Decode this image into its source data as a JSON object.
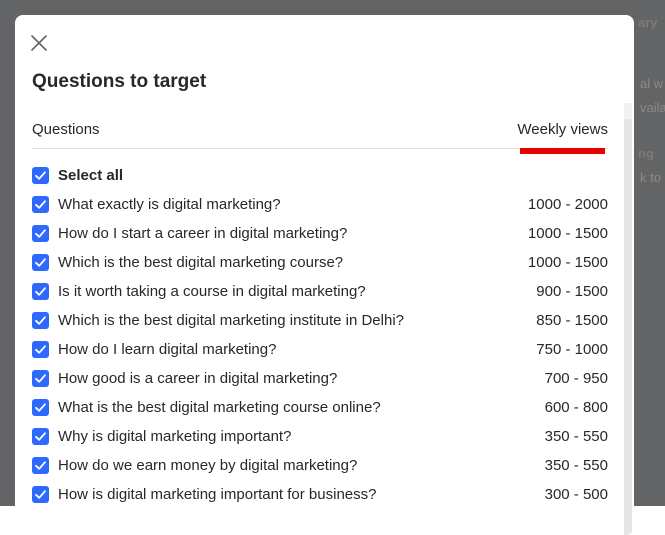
{
  "background": {
    "snippets": [
      "ary",
      "al w",
      "vaila",
      "ng",
      "k to"
    ]
  },
  "modal": {
    "title": "Questions to target",
    "columns": {
      "questions": "Questions",
      "weekly_views": "Weekly views"
    },
    "select_all": {
      "label": "Select all",
      "checked": true
    },
    "questions": [
      {
        "text": "What exactly is digital marketing?",
        "views": "1000 - 2000",
        "checked": true
      },
      {
        "text": "How do I start a career in digital marketing?",
        "views": "1000 - 1500",
        "checked": true
      },
      {
        "text": "Which is the best digital marketing course?",
        "views": "1000 - 1500",
        "checked": true
      },
      {
        "text": "Is it worth taking a course in digital marketing?",
        "views": "900 - 1500",
        "checked": true
      },
      {
        "text": "Which is the best digital marketing institute in Delhi?",
        "views": "850 - 1500",
        "checked": true
      },
      {
        "text": "How do I learn digital marketing?",
        "views": "750 - 1000",
        "checked": true
      },
      {
        "text": "How good is a career in digital marketing?",
        "views": "700 - 950",
        "checked": true
      },
      {
        "text": "What is the best digital marketing course online?",
        "views": "600 - 800",
        "checked": true
      },
      {
        "text": "Why is digital marketing important?",
        "views": "350 - 550",
        "checked": true
      },
      {
        "text": "How do we earn money by digital marketing?",
        "views": "350 - 550",
        "checked": true
      },
      {
        "text": "How is digital marketing important for business?",
        "views": "300 - 500",
        "checked": true
      }
    ]
  },
  "colors": {
    "accent": "#2e69ff",
    "highlight_underline": "#e60000",
    "text": "#282829",
    "backdrop": "#636466"
  },
  "icons": {
    "close": "close-icon",
    "check": "checkmark-icon"
  }
}
